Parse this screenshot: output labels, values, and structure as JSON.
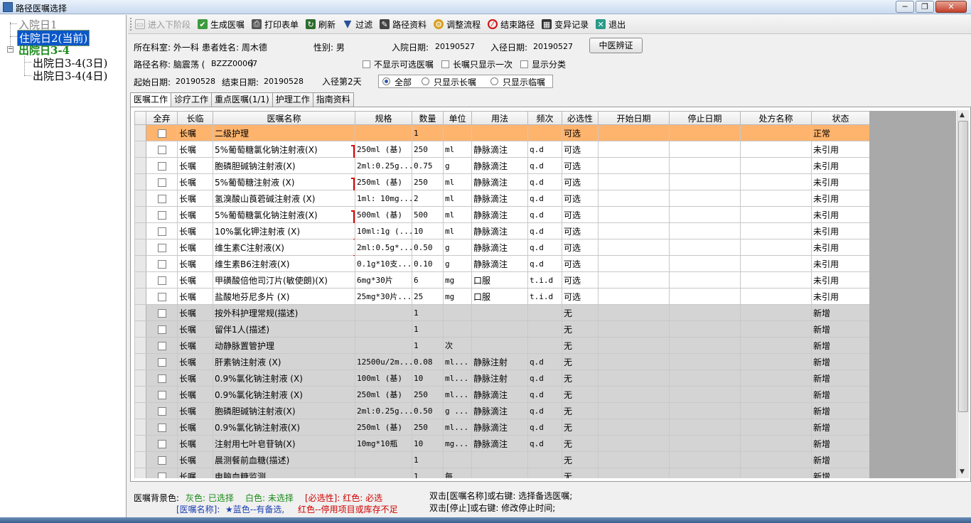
{
  "window": {
    "title": "路径医嘱选择",
    "buttons": [
      "─",
      "❐",
      "✕"
    ]
  },
  "tree": {
    "nodes": [
      {
        "label": "入院日1",
        "style": "gray"
      },
      {
        "label": "住院日2(当前)",
        "style": "sel"
      },
      {
        "label": "出院日3-4",
        "style": "green"
      },
      {
        "label": "出院日3-4(3日)",
        "style": "normal"
      },
      {
        "label": "出院日3-4(4日)",
        "style": "normal"
      }
    ]
  },
  "toolbar": {
    "items": [
      {
        "label": "进入下阶段",
        "icon": "next-stage-icon",
        "disabled": true
      },
      {
        "label": "生成医嘱",
        "icon": "check-icon",
        "disabled": false
      },
      {
        "label": "打印表单",
        "icon": "printer-icon",
        "disabled": false
      },
      {
        "label": "刷新",
        "icon": "refresh-icon",
        "disabled": false
      },
      {
        "label": "过滤",
        "icon": "filter-icon",
        "disabled": false
      },
      {
        "label": "路径资料",
        "icon": "book-icon",
        "disabled": false
      },
      {
        "label": "调整流程",
        "icon": "flow-icon",
        "disabled": false
      },
      {
        "label": "结束路径",
        "icon": "stop-icon",
        "disabled": false
      },
      {
        "label": "变异记录",
        "icon": "record-icon",
        "disabled": false
      },
      {
        "label": "退出",
        "icon": "exit-icon",
        "disabled": false
      }
    ]
  },
  "info": {
    "dept": "所在科室: 外一科",
    "patient": "患者姓名: 周木德",
    "gender": "性别: 男",
    "admit_label": "入院日期:",
    "admit_date": "20190527",
    "path_in_label": "入径日期:",
    "path_in_date": "20190527",
    "tcm_button": "中医辨证",
    "path_name_label": "路径名称: 脑震荡 (",
    "path_code": "BZZZ00067",
    "path_name_close": ")",
    "chk_hide_optional": "不显示可选医嘱",
    "chk_long_once": "长嘱只显示一次",
    "chk_show_category": "显示分类",
    "start_label": "起始日期:",
    "start_date": "20190528",
    "end_label": "结束日期:",
    "end_date": "20190528",
    "day_in_path": "入径第2天",
    "radio_all": "全部",
    "radio_long": "只显示长嘱",
    "radio_temp": "只显示临嘱"
  },
  "tabs": [
    "医嘱工作",
    "诊疗工作",
    "重点医嘱(1/1)",
    "护理工作",
    "指南资料"
  ],
  "grid": {
    "columns": [
      "全弃",
      "长临",
      "医嘱名称",
      "规格",
      "数量",
      "单位",
      "用法",
      "频次",
      "必选性",
      "开始日期",
      "停止日期",
      "处方名称",
      "状态"
    ],
    "rows": [
      {
        "type": "长嘱",
        "name": "二级护理",
        "spec": "",
        "qty": "1",
        "unit": "",
        "usage": "",
        "freq": "",
        "req": "可选",
        "start": "",
        "stop": "",
        "rx": "",
        "status": "正常",
        "bg": "orange"
      },
      {
        "type": "长嘱",
        "name": "5%葡萄糖氯化钠注射液(X)",
        "spec": "250ml (基)",
        "qty": "250",
        "unit": "ml",
        "usage": "静脉滴注",
        "freq": "q.d",
        "req": "可选",
        "start": "",
        "stop": "",
        "rx": "",
        "status": "未引用",
        "bg": "white"
      },
      {
        "type": "长嘱",
        "name": "胞磷胆碱钠注射液(X)",
        "spec": "2ml:0.25g...",
        "qty": "0.75",
        "unit": "g",
        "usage": "静脉滴注",
        "freq": "q.d",
        "req": "可选",
        "start": "",
        "stop": "",
        "rx": "",
        "status": "未引用",
        "bg": "white"
      },
      {
        "type": "长嘱",
        "name": "5%葡萄糖注射液 (X)",
        "spec": "250ml (基)",
        "qty": "250",
        "unit": "ml",
        "usage": "静脉滴注",
        "freq": "q.d",
        "req": "可选",
        "start": "",
        "stop": "",
        "rx": "",
        "status": "未引用",
        "bg": "white"
      },
      {
        "type": "长嘱",
        "name": "氢溴酸山莨菪碱注射液 (X)",
        "spec": "1ml: 10mg...",
        "qty": "2",
        "unit": "ml",
        "usage": "静脉滴注",
        "freq": "q.d",
        "req": "可选",
        "start": "",
        "stop": "",
        "rx": "",
        "status": "未引用",
        "bg": "white"
      },
      {
        "type": "长嘱",
        "name": "5%葡萄糖氯化钠注射液(X)",
        "spec": "500ml (基)",
        "qty": "500",
        "unit": "ml",
        "usage": "静脉滴注",
        "freq": "q.d",
        "req": "可选",
        "start": "",
        "stop": "",
        "rx": "",
        "status": "未引用",
        "bg": "white"
      },
      {
        "type": "长嘱",
        "name": "10%氯化钾注射液 (X)",
        "spec": "10ml:1g (...",
        "qty": "10",
        "unit": "ml",
        "usage": "静脉滴注",
        "freq": "q.d",
        "req": "可选",
        "start": "",
        "stop": "",
        "rx": "",
        "status": "未引用",
        "bg": "white"
      },
      {
        "type": "长嘱",
        "name": "维生素C注射液(X)",
        "spec": "2ml:0.5g*...",
        "qty": "0.50",
        "unit": "g",
        "usage": "静脉滴注",
        "freq": "q.d",
        "req": "可选",
        "start": "",
        "stop": "",
        "rx": "",
        "status": "未引用",
        "bg": "white"
      },
      {
        "type": "长嘱",
        "name": "维生素B6注射液(X)",
        "spec": "0.1g*10支...",
        "qty": "0.10",
        "unit": "g",
        "usage": "静脉滴注",
        "freq": "q.d",
        "req": "可选",
        "start": "",
        "stop": "",
        "rx": "",
        "status": "未引用",
        "bg": "white"
      },
      {
        "type": "长嘱",
        "name": "甲磺酸倍他司汀片(敏使朗)(X)",
        "spec": "6mg*30片",
        "qty": "6",
        "unit": "mg",
        "usage": "口服",
        "freq": "t.i.d",
        "req": "可选",
        "start": "",
        "stop": "",
        "rx": "",
        "status": "未引用",
        "bg": "white"
      },
      {
        "type": "长嘱",
        "name": "盐酸地芬尼多片 (X)",
        "spec": "25mg*30片...",
        "qty": "25",
        "unit": "mg",
        "usage": "口服",
        "freq": "t.i.d",
        "req": "可选",
        "start": "",
        "stop": "",
        "rx": "",
        "status": "未引用",
        "bg": "white"
      },
      {
        "type": "长嘱",
        "name": "按外科护理常规(描述)",
        "spec": "",
        "qty": "1",
        "unit": "",
        "usage": "",
        "freq": "",
        "req": "无",
        "start": "",
        "stop": "",
        "rx": "",
        "status": "新增",
        "bg": "gray"
      },
      {
        "type": "长嘱",
        "name": "留伴1人(描述)",
        "spec": "",
        "qty": "1",
        "unit": "",
        "usage": "",
        "freq": "",
        "req": "无",
        "start": "",
        "stop": "",
        "rx": "",
        "status": "新增",
        "bg": "gray"
      },
      {
        "type": "长嘱",
        "name": "动静脉置管护理",
        "spec": "",
        "qty": "1",
        "unit": "次",
        "usage": "",
        "freq": "",
        "req": "无",
        "start": "",
        "stop": "",
        "rx": "",
        "status": "新增",
        "bg": "gray"
      },
      {
        "type": "长嘱",
        "name": "肝素钠注射液 (X)",
        "spec": "12500u/2m...",
        "qty": "0.08",
        "unit": "ml...",
        "usage": "静脉注射",
        "freq": "q.d",
        "req": "无",
        "start": "",
        "stop": "",
        "rx": "",
        "status": "新增",
        "bg": "gray"
      },
      {
        "type": "长嘱",
        "name": "0.9%氯化钠注射液 (X)",
        "spec": "100ml (基)",
        "qty": "10",
        "unit": "ml...",
        "usage": "静脉注射",
        "freq": "q.d",
        "req": "无",
        "start": "",
        "stop": "",
        "rx": "",
        "status": "新增",
        "bg": "gray"
      },
      {
        "type": "长嘱",
        "name": "0.9%氯化钠注射液 (X)",
        "spec": "250ml (基)",
        "qty": "250",
        "unit": "ml...",
        "usage": "静脉滴注",
        "freq": "q.d",
        "req": "无",
        "start": "",
        "stop": "",
        "rx": "",
        "status": "新增",
        "bg": "gray"
      },
      {
        "type": "长嘱",
        "name": "胞磷胆碱钠注射液(X)",
        "spec": "2ml:0.25g...",
        "qty": "0.50",
        "unit": "g ...",
        "usage": "静脉滴注",
        "freq": "q.d",
        "req": "无",
        "start": "",
        "stop": "",
        "rx": "",
        "status": "新增",
        "bg": "gray"
      },
      {
        "type": "长嘱",
        "name": "0.9%氯化钠注射液(X)",
        "spec": "250ml (基)",
        "qty": "250",
        "unit": "ml...",
        "usage": "静脉滴注",
        "freq": "q.d",
        "req": "无",
        "start": "",
        "stop": "",
        "rx": "",
        "status": "新增",
        "bg": "gray"
      },
      {
        "type": "长嘱",
        "name": "注射用七叶皂苷钠(X)",
        "spec": "10mg*10瓶",
        "qty": "10",
        "unit": "mg...",
        "usage": "静脉滴注",
        "freq": "q.d",
        "req": "无",
        "start": "",
        "stop": "",
        "rx": "",
        "status": "新增",
        "bg": "gray"
      },
      {
        "type": "长嘱",
        "name": "晨测餐前血糖(描述)",
        "spec": "",
        "qty": "1",
        "unit": "",
        "usage": "",
        "freq": "",
        "req": "无",
        "start": "",
        "stop": "",
        "rx": "",
        "status": "新增",
        "bg": "gray"
      },
      {
        "type": "长嘱",
        "name": "电脑血糖监测",
        "spec": "",
        "qty": "1",
        "unit": "每",
        "usage": "",
        "freq": "",
        "req": "无",
        "start": "",
        "stop": "",
        "rx": "",
        "status": "新增",
        "bg": "gray"
      }
    ]
  },
  "legend": {
    "prefix": "医嘱背景色:",
    "gray": "灰色: 已选择",
    "white": "白色: 未选择",
    "required": "[必选性]: 红色: 必选",
    "name_prefix": "[医嘱名称]:",
    "blue": "★蓝色--有备选,",
    "red": "红色--停用项目或库存不足",
    "hint1": "双击[医嘱名称]或右键: 选择备选医嘱;",
    "hint2": "双击[停止]或右键: 修改停止时间;"
  },
  "colors": {
    "selected_row": "#ffb46e",
    "gray_row": "#d4d4d4",
    "bracket": "#e00000",
    "tree_green": "#1a8a1a",
    "tree_selected": "#0a57c9"
  }
}
